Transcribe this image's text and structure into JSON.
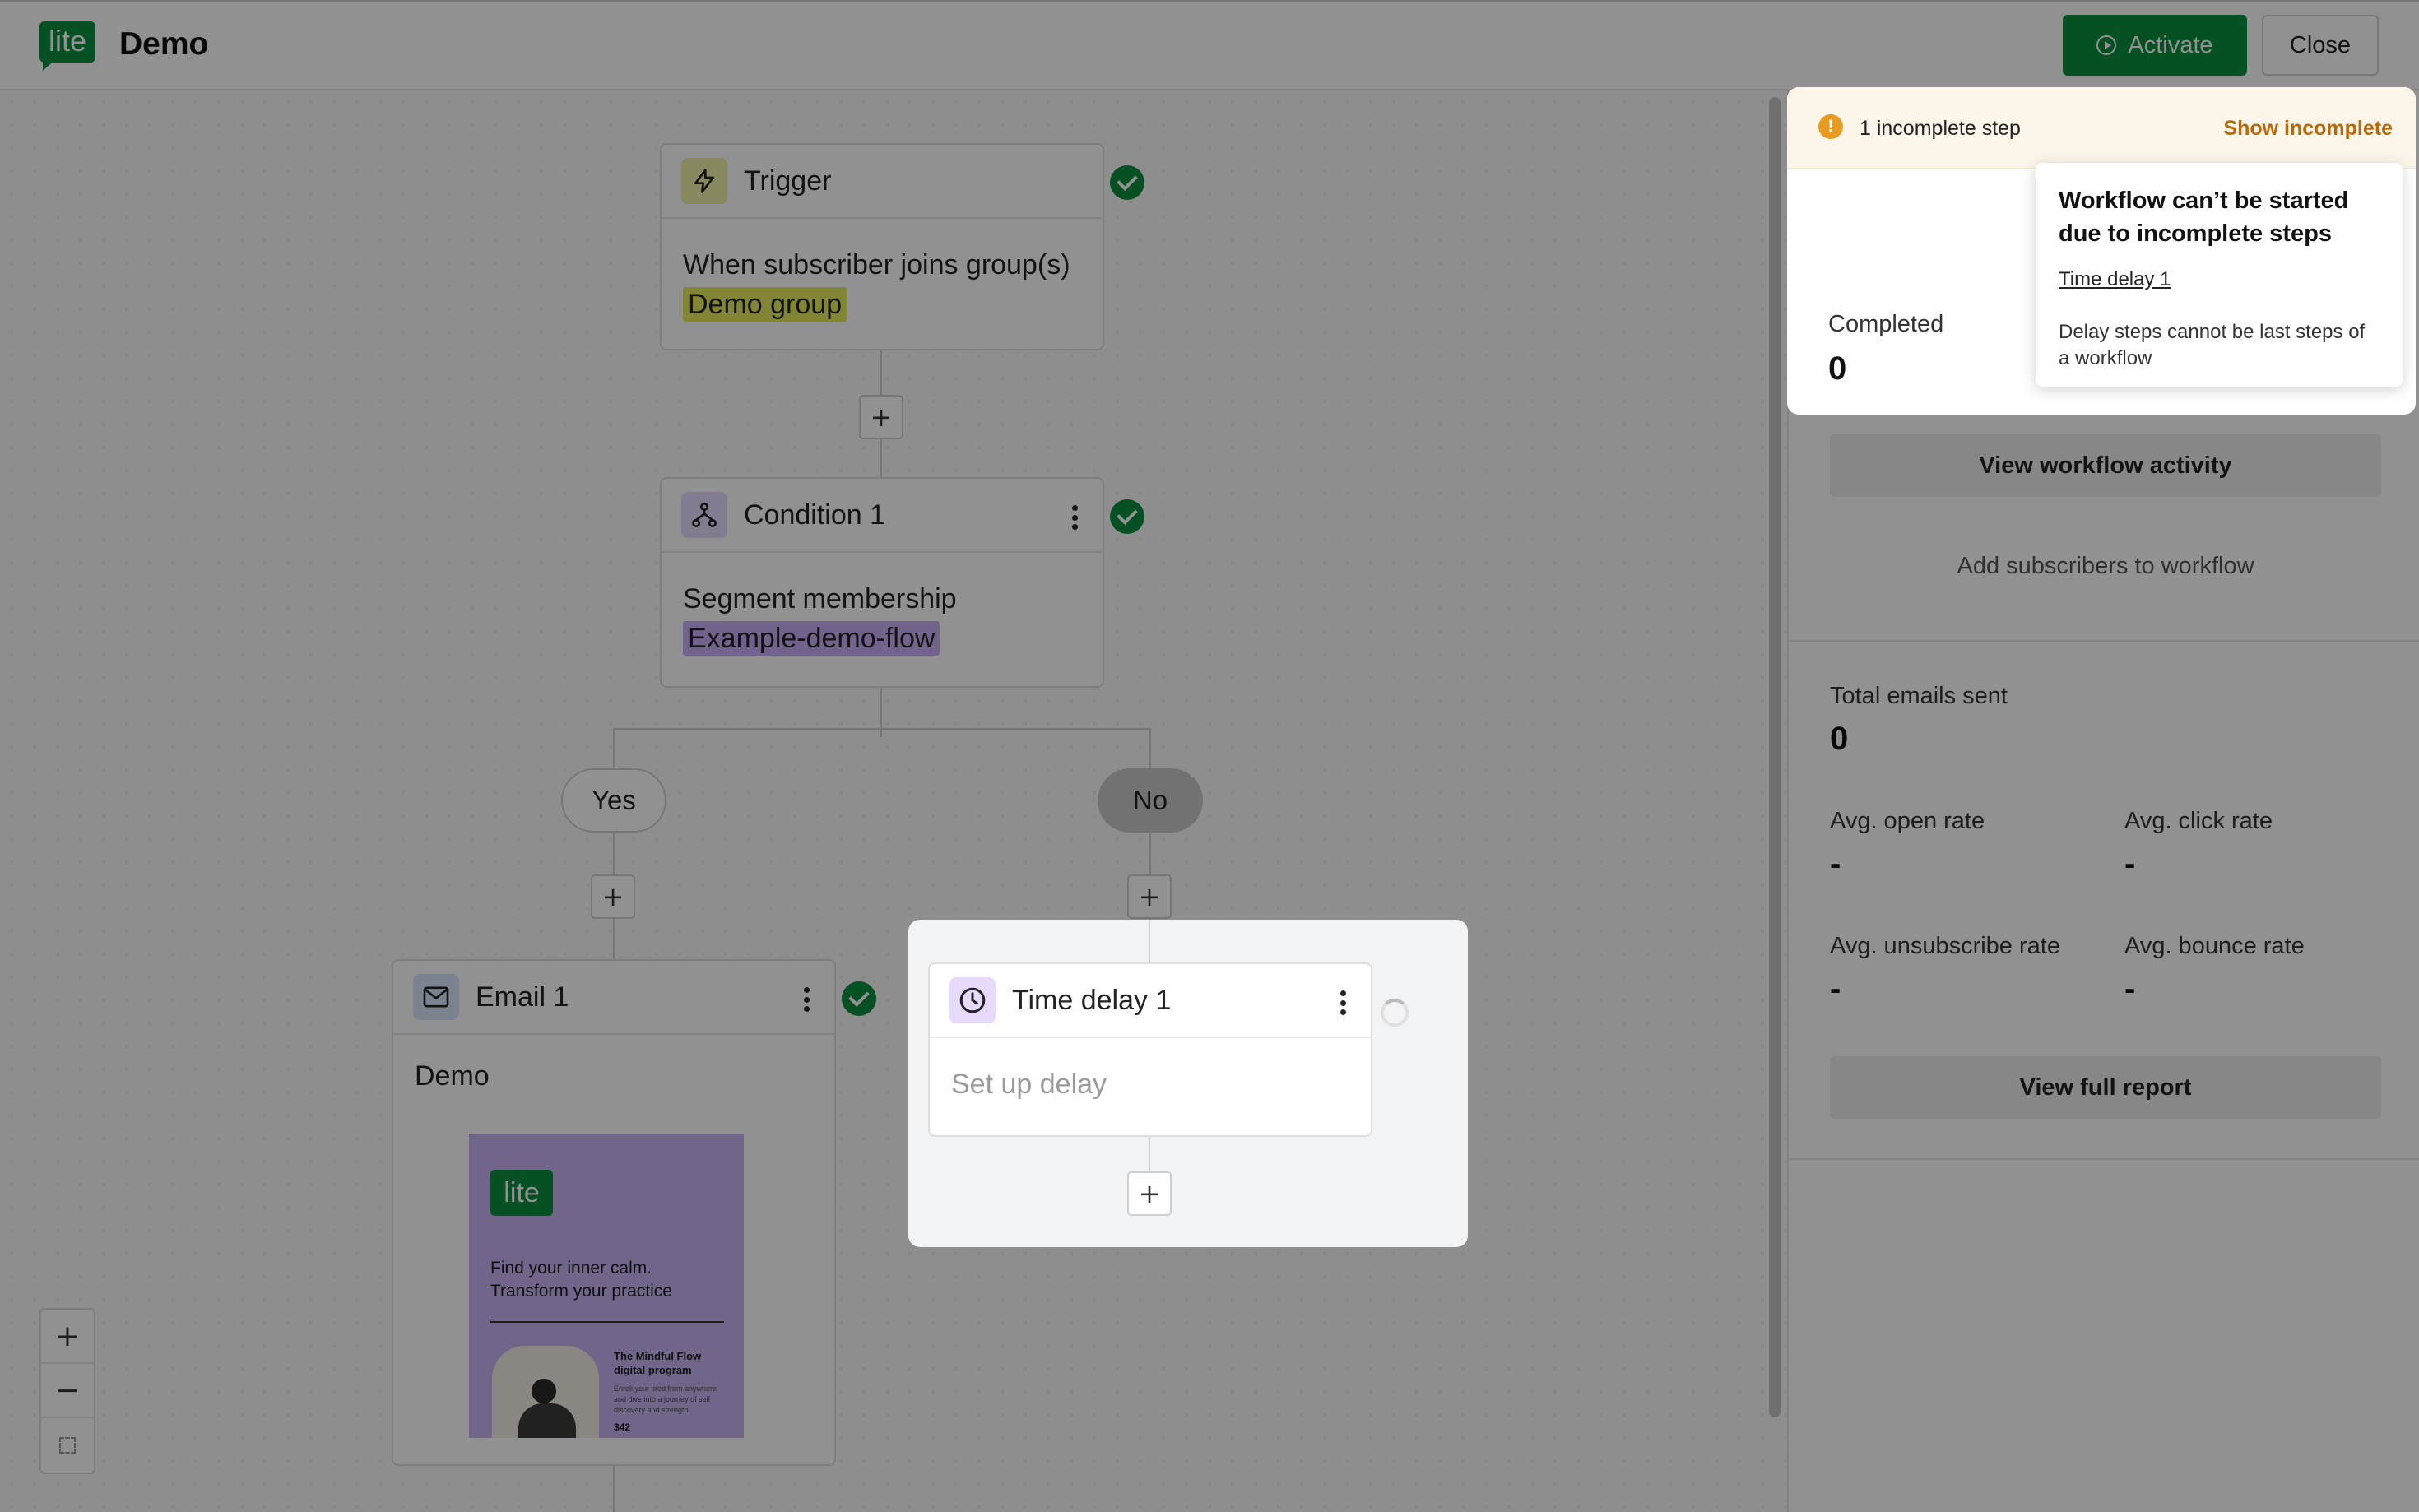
{
  "header": {
    "logo_text": "lite",
    "title": "Demo",
    "activate_label": "Activate",
    "close_label": "Close"
  },
  "workflow": {
    "trigger": {
      "title": "Trigger",
      "description": "When subscriber joins group(s)",
      "group": "Demo group",
      "complete": true
    },
    "add_step_symbol": "+",
    "condition": {
      "title": "Condition 1",
      "description": "Segment membership",
      "segment": "Example-demo-flow",
      "complete": true
    },
    "branches": {
      "yes_label": "Yes",
      "no_label": "No"
    },
    "email": {
      "title": "Email 1",
      "subject": "Demo",
      "complete": true,
      "preview": {
        "logo_text": "lite",
        "headline": "Find your inner calm. Transform your practice",
        "program": "The Mindful Flow digital program",
        "blurb": "Enroll your tired from anywhere and dive into a journey of self discovery and strength",
        "price": "$42"
      }
    },
    "time_delay": {
      "title": "Time delay 1",
      "placeholder": "Set up delay",
      "complete": false
    }
  },
  "zoom": {
    "zoom_in": "+",
    "zoom_out": "−"
  },
  "panel": {
    "banner": {
      "text": "1 incomplete step",
      "action": "Show incomplete"
    },
    "tooltip": {
      "title": "Workflow can’t be started due to incomplete steps",
      "step_link": "Time delay 1",
      "description": "Delay steps cannot be last steps of a workflow"
    },
    "completed": {
      "label": "Completed",
      "value": "0"
    },
    "view_activity_label": "View workflow activity",
    "add_subscribers_label": "Add subscribers to workflow",
    "stats": {
      "total_emails": {
        "label": "Total emails sent",
        "value": "0"
      },
      "open_rate": {
        "label": "Avg. open rate",
        "value": "-"
      },
      "click_rate": {
        "label": "Avg. click rate",
        "value": "-"
      },
      "unsubscribe_rate": {
        "label": "Avg. unsubscribe rate",
        "value": "-"
      },
      "bounce_rate": {
        "label": "Avg. bounce rate",
        "value": "-"
      }
    },
    "view_report_label": "View full report"
  },
  "colors": {
    "brand": "#0b8f3e",
    "warning": "#e89b23",
    "warning_link": "#b86a0a",
    "overlay": "rgba(0,0,0,0.43)"
  }
}
